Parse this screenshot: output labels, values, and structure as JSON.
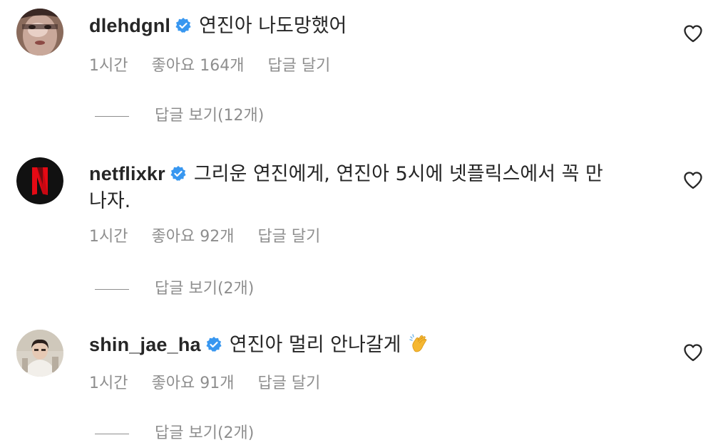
{
  "comments": [
    {
      "username": "dlehdgnl",
      "verified": true,
      "text_line1": "연진아 나도망했어",
      "text_line2": "",
      "time": "1시간",
      "likes": "좋아요 164개",
      "reply": "답글 달기",
      "view_replies": "답글 보기(12개)",
      "avatar_icon": "photo-avatar"
    },
    {
      "username": "netflixkr",
      "verified": true,
      "text_line1": "그리운 연진에게, 연진아 5시에 넷플릭스에서 꼭 만",
      "text_line2": "나자.",
      "time": "1시간",
      "likes": "좋아요 92개",
      "reply": "답글 달기",
      "view_replies": "답글 보기(2개)",
      "avatar_icon": "netflix-logo"
    },
    {
      "username": "shin_jae_ha",
      "verified": true,
      "text_line1": "연진아 멀리 안나갈게",
      "text_line2": "",
      "emoji_icon": "clapping-hands-emoji",
      "time": "1시간",
      "likes": "좋아요 91개",
      "reply": "답글 달기",
      "view_replies": "답글 보기(2개)",
      "avatar_icon": "photo-avatar"
    }
  ],
  "colors": {
    "verified_badge": "#3897f0",
    "meta_text": "#8e8e8e",
    "netflix_red": "#e50914",
    "clap_yellow": "#f5b731"
  }
}
